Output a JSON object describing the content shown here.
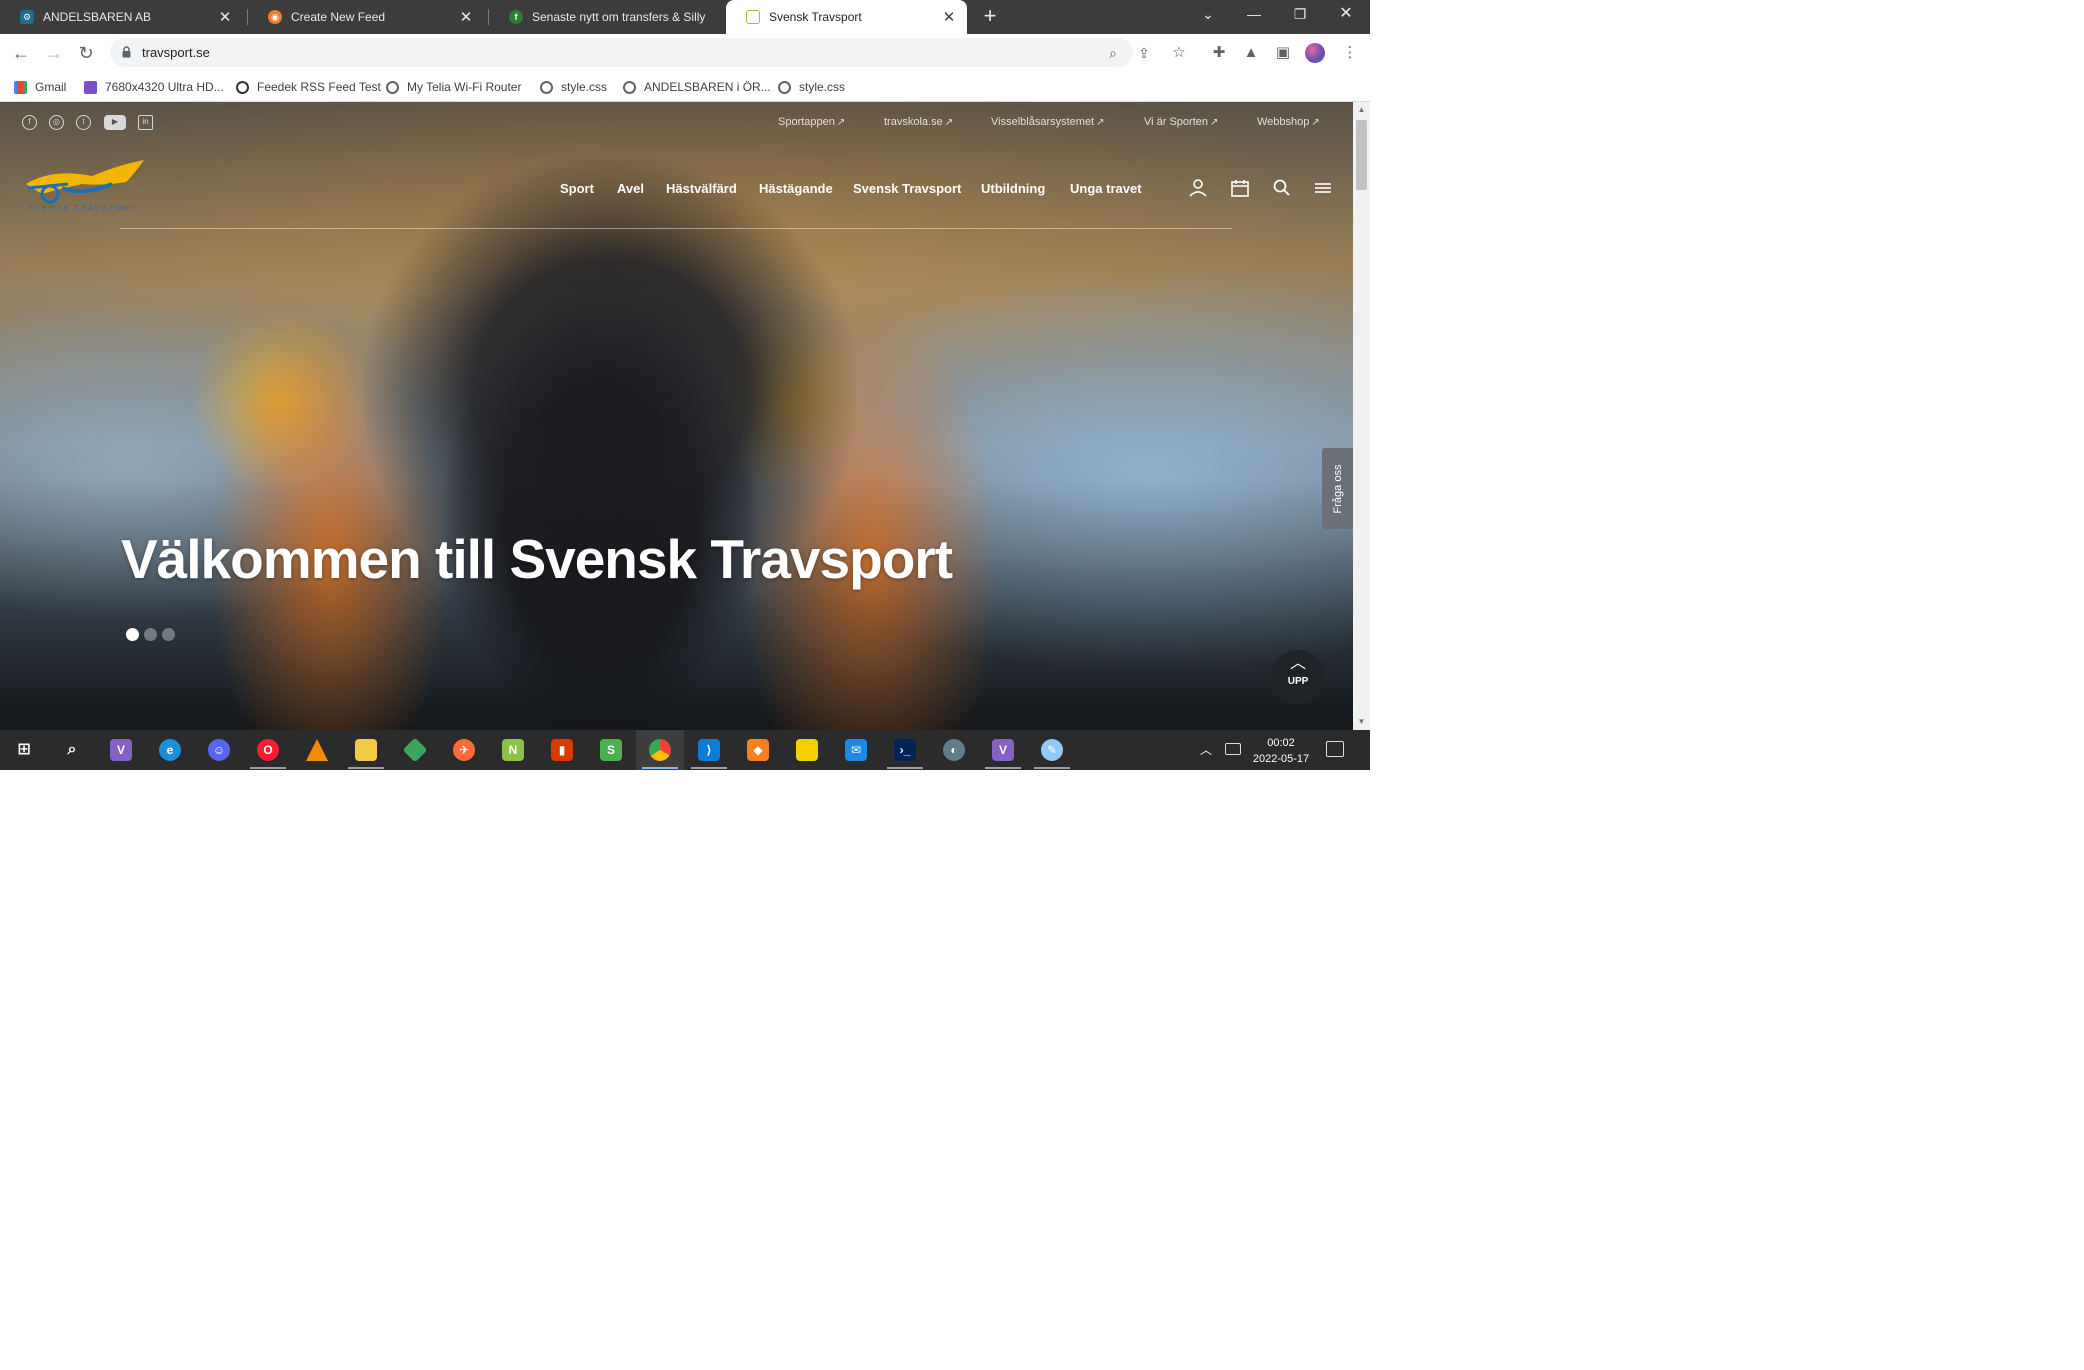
{
  "browser": {
    "tabs": [
      {
        "title": "ANDELSBAREN AB",
        "active": false,
        "favicon_color": "#1b6e8e"
      },
      {
        "title": "Create New Feed",
        "active": false,
        "favicon_color": "#f07c2a"
      },
      {
        "title": "Senaste nytt om transfers & Silly",
        "active": false,
        "favicon_color": "#2e7d32"
      },
      {
        "title": "Svensk Travsport",
        "active": true,
        "favicon_color": "#8bc34a"
      }
    ],
    "url": "travsport.se",
    "bookmarks": [
      {
        "label": "Gmail",
        "icon": "gmail-icon"
      },
      {
        "label": "7680x4320 Ultra HD...",
        "icon": "8k-icon"
      },
      {
        "label": "Feedek RSS Feed Test",
        "icon": "feedek-icon"
      },
      {
        "label": "My Telia Wi-Fi Router",
        "icon": "globe-icon"
      },
      {
        "label": "style.css",
        "icon": "globe-icon"
      },
      {
        "label": "ANDELSBAREN i ÖR...",
        "icon": "globe-icon"
      },
      {
        "label": "style.css",
        "icon": "globe-icon"
      }
    ]
  },
  "site": {
    "top_links": [
      "Sportappen",
      "travskola.se",
      "Visselblåsarsystemet",
      "Vi är Sporten",
      "Webbshop"
    ],
    "social_icons": [
      "facebook-icon",
      "instagram-icon",
      "twitter-icon",
      "youtube-icon",
      "linkedin-icon"
    ],
    "logo_text": "SVENSK TRAVSPORT",
    "nav": [
      "Sport",
      "Avel",
      "Hästvälfärd",
      "Hästägande",
      "Svensk Travsport",
      "Utbildning",
      "Unga travet"
    ],
    "hero_title": "Välkommen till Svensk Travsport",
    "slides_count": 3,
    "active_slide": 1,
    "ask_label": "Fråga oss",
    "up_label": "UPP"
  },
  "taskbar": {
    "apps": [
      "windows-start",
      "search",
      "visual-studio",
      "edge",
      "discord",
      "opera",
      "vlc",
      "file-explorer",
      "git",
      "postman",
      "notepad-plus",
      "office",
      "sticky-app",
      "chrome",
      "vscode",
      "sourcetree",
      "sticky-notes",
      "mail",
      "powershell",
      "app-store",
      "visual-studio-2",
      "paint"
    ],
    "time": "00:02",
    "date": "2022-05-17"
  },
  "colors": {
    "tab_bg": "#3c3c3c",
    "taskbar_bg": "#2b2b2b",
    "logo_yellow": "#f2b705",
    "logo_blue": "#1d6fb8"
  }
}
